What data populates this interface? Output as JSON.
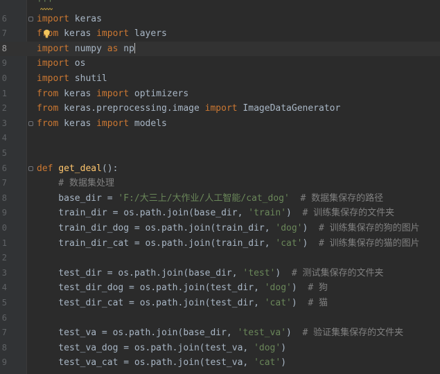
{
  "colors": {
    "background": "#2b2b2b",
    "gutter": "#313335",
    "keyword": "#cc7832",
    "string": "#6a8759",
    "comment": "#808080",
    "function_name": "#ffc66d",
    "plain": "#a9b7c6",
    "line_number": "#606366"
  },
  "icons": [
    "fold-marker-icon",
    "lightbulb-intention-icon"
  ],
  "editor": {
    "current_line_number": "8",
    "lines": [
      {
        "number": "",
        "tokens": [
          {
            "t": "'''",
            "c": "str"
          }
        ]
      },
      {
        "number": "6",
        "tokens": [
          {
            "t": "import",
            "c": "kw"
          },
          {
            "t": " keras",
            "c": "pl"
          }
        ]
      },
      {
        "number": "7",
        "tokens": [
          {
            "t": "from",
            "c": "kw"
          },
          {
            "t": " keras ",
            "c": "pl"
          },
          {
            "t": "import",
            "c": "kw"
          },
          {
            "t": " layers",
            "c": "pl"
          }
        ]
      },
      {
        "number": "8",
        "tokens": [
          {
            "t": "import",
            "c": "kw"
          },
          {
            "t": " numpy ",
            "c": "pl"
          },
          {
            "t": "as",
            "c": "kw"
          },
          {
            "t": " np",
            "c": "pl"
          }
        ]
      },
      {
        "number": "9",
        "tokens": [
          {
            "t": "import",
            "c": "kw"
          },
          {
            "t": " os",
            "c": "pl"
          }
        ]
      },
      {
        "number": "0",
        "tokens": [
          {
            "t": "import",
            "c": "kw"
          },
          {
            "t": " shutil",
            "c": "pl"
          }
        ]
      },
      {
        "number": "1",
        "tokens": [
          {
            "t": "from",
            "c": "kw"
          },
          {
            "t": " keras ",
            "c": "pl"
          },
          {
            "t": "import",
            "c": "kw"
          },
          {
            "t": " optimizers",
            "c": "pl"
          }
        ]
      },
      {
        "number": "2",
        "tokens": [
          {
            "t": "from",
            "c": "kw"
          },
          {
            "t": " keras.preprocessing.image ",
            "c": "pl"
          },
          {
            "t": "import",
            "c": "kw"
          },
          {
            "t": " ImageDataGenerator",
            "c": "pl"
          }
        ]
      },
      {
        "number": "3",
        "tokens": [
          {
            "t": "from",
            "c": "kw"
          },
          {
            "t": " keras ",
            "c": "pl"
          },
          {
            "t": "import",
            "c": "kw"
          },
          {
            "t": " models",
            "c": "pl"
          }
        ]
      },
      {
        "number": "4",
        "tokens": []
      },
      {
        "number": "5",
        "tokens": []
      },
      {
        "number": "6",
        "tokens": [
          {
            "t": "def",
            "c": "kw"
          },
          {
            "t": " ",
            "c": "pl"
          },
          {
            "t": "get_deal",
            "c": "fn"
          },
          {
            "t": "():",
            "c": "pl"
          }
        ]
      },
      {
        "number": "7",
        "tokens": [
          {
            "t": "    # 数据集处理",
            "c": "cm"
          }
        ]
      },
      {
        "number": "8",
        "tokens": [
          {
            "t": "    base_dir = ",
            "c": "pl"
          },
          {
            "t": "'F:/大三上/大作业/人工智能/cat_dog'",
            "c": "str"
          },
          {
            "t": "  # 数据集保存的路径",
            "c": "cm"
          }
        ]
      },
      {
        "number": "9",
        "tokens": [
          {
            "t": "    train_dir = os.path.join(base_dir, ",
            "c": "pl"
          },
          {
            "t": "'train'",
            "c": "str"
          },
          {
            "t": ")",
            "c": "pl"
          },
          {
            "t": "  # 训练集保存的文件夹",
            "c": "cm"
          }
        ]
      },
      {
        "number": "0",
        "tokens": [
          {
            "t": "    train_dir_dog = os.path.join(train_dir, ",
            "c": "pl"
          },
          {
            "t": "'dog'",
            "c": "str"
          },
          {
            "t": ")",
            "c": "pl"
          },
          {
            "t": "  # 训练集保存的狗的图片",
            "c": "cm"
          }
        ]
      },
      {
        "number": "1",
        "tokens": [
          {
            "t": "    train_dir_cat = os.path.join(train_dir, ",
            "c": "pl"
          },
          {
            "t": "'cat'",
            "c": "str"
          },
          {
            "t": ")",
            "c": "pl"
          },
          {
            "t": "  # 训练集保存的猫的图片",
            "c": "cm"
          }
        ]
      },
      {
        "number": "2",
        "tokens": []
      },
      {
        "number": "3",
        "tokens": [
          {
            "t": "    test_dir = os.path.join(base_dir, ",
            "c": "pl"
          },
          {
            "t": "'test'",
            "c": "str"
          },
          {
            "t": ")",
            "c": "pl"
          },
          {
            "t": "  # 测试集保存的文件夹",
            "c": "cm"
          }
        ]
      },
      {
        "number": "4",
        "tokens": [
          {
            "t": "    test_dir_dog = os.path.join(test_dir, ",
            "c": "pl"
          },
          {
            "t": "'dog'",
            "c": "str"
          },
          {
            "t": ")",
            "c": "pl"
          },
          {
            "t": "  # 狗",
            "c": "cm"
          }
        ]
      },
      {
        "number": "5",
        "tokens": [
          {
            "t": "    test_dir_cat = os.path.join(test_dir, ",
            "c": "pl"
          },
          {
            "t": "'cat'",
            "c": "str"
          },
          {
            "t": ")",
            "c": "pl"
          },
          {
            "t": "  # 猫",
            "c": "cm"
          }
        ]
      },
      {
        "number": "6",
        "tokens": []
      },
      {
        "number": "7",
        "tokens": [
          {
            "t": "    test_va = os.path.join(base_dir, ",
            "c": "pl"
          },
          {
            "t": "'test_va'",
            "c": "str"
          },
          {
            "t": ")",
            "c": "pl"
          },
          {
            "t": "  # 验证集集保存的文件夹",
            "c": "cm"
          }
        ]
      },
      {
        "number": "8",
        "tokens": [
          {
            "t": "    test_va_dog = os.path.join(test_va, ",
            "c": "pl"
          },
          {
            "t": "'dog'",
            "c": "str"
          },
          {
            "t": ")",
            "c": "pl"
          }
        ]
      },
      {
        "number": "9",
        "tokens": [
          {
            "t": "    test_va_cat = os.path.join(test_va, ",
            "c": "pl"
          },
          {
            "t": "'cat'",
            "c": "str"
          },
          {
            "t": ")",
            "c": "pl"
          }
        ]
      }
    ]
  }
}
